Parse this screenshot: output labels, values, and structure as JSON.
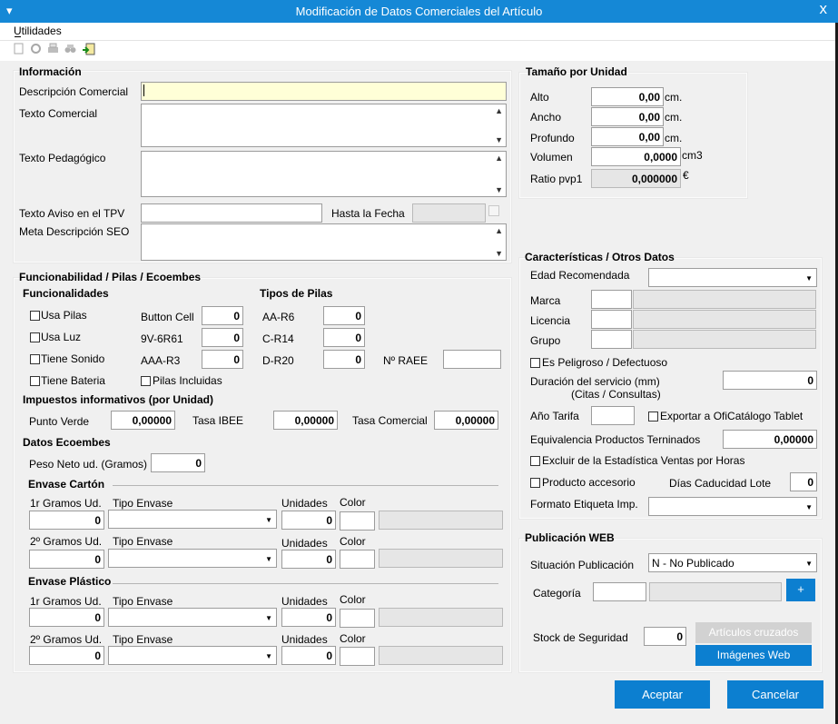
{
  "window": {
    "title": "Modificación de Datos Comerciales del Artículo",
    "close_glyph": "x",
    "sys_glyph": "▾"
  },
  "menu": {
    "utilidades": "Utilidades"
  },
  "toolbar": {
    "icons": [
      "new-doc-icon",
      "refresh-icon",
      "print-icon",
      "binoculars-icon",
      "exit-icon"
    ]
  },
  "info": {
    "heading": "Información",
    "descripcion_label": "Descripción Comercial",
    "descripcion_value": "",
    "texto_comercial_label": "Texto Comercial",
    "texto_pedagogico_label": "Texto Pedagógico",
    "aviso_label": "Texto Aviso en el TPV",
    "hasta_fecha_label": "Hasta la Fecha",
    "meta_label": "Meta Descripción SEO"
  },
  "funcionalidad": {
    "heading": "Funcionabilidad / Pilas / Ecoembes",
    "funcionalidades_heading": "Funcionalidades",
    "tipos_pilas_heading": "Tipos de Pilas",
    "checks": [
      "Usa Pilas",
      "Usa Luz",
      "Tiene Sonido",
      "Tiene Bateria"
    ],
    "pilas_incluidas": "Pilas Incluidas",
    "col1": [
      {
        "label": "Button Cell",
        "value": "0"
      },
      {
        "label": "9V-6R61",
        "value": "0"
      },
      {
        "label": "AAA-R3",
        "value": "0"
      }
    ],
    "col2": [
      {
        "label": "AA-R6",
        "value": "0"
      },
      {
        "label": "C-R14",
        "value": "0"
      },
      {
        "label": "D-R20",
        "value": "0"
      }
    ],
    "raee_label": "Nº RAEE",
    "impuestos_heading": "Impuestos informativos (por Unidad)",
    "punto_verde_label": "Punto Verde",
    "punto_verde_value": "0,00000",
    "tasa_ibee_label": "Tasa IBEE",
    "tasa_ibee_value": "0,00000",
    "tasa_comercial_label": "Tasa Comercial",
    "tasa_comercial_value": "0,00000",
    "ecoembes_heading": "Datos Ecoembes",
    "peso_label": "Peso Neto ud. (Gramos)",
    "peso_value": "0",
    "carton_heading": "Envase Cartón",
    "plastico_heading": "Envase Plástico",
    "row1_label": "1r Gramos Ud.",
    "row2_label": "2º Gramos Ud.",
    "tipo_envase_label": "Tipo Envase",
    "unidades_label": "Unidades",
    "color_label": "Color",
    "zero": "0"
  },
  "tamano": {
    "heading": "Tamaño por Unidad",
    "alto_label": "Alto",
    "alto_value": "0,00",
    "alto_unit": "cm.",
    "ancho_label": "Ancho",
    "ancho_value": "0,00",
    "ancho_unit": "cm.",
    "profundo_label": "Profundo",
    "profundo_value": "0,00",
    "profundo_unit": "cm.",
    "volumen_label": "Volumen",
    "volumen_value": "0,0000",
    "volumen_unit": "cm3",
    "ratio_label": "Ratio pvp1",
    "ratio_value": "0,000000",
    "ratio_unit": "€"
  },
  "caracteristicas": {
    "heading": "Características / Otros Datos",
    "edad_label": "Edad Recomendada",
    "marca_label": "Marca",
    "licencia_label": "Licencia",
    "grupo_label": "Grupo",
    "peligroso_label": "Es Peligroso / Defectuoso",
    "duracion_label": "Duración del servicio (mm)",
    "duracion_sub": "(Citas / Consultas)",
    "duracion_value": "0",
    "ano_tarifa_label": "Año Tarifa",
    "exportar_label": "Exportar a OfiCatálogo Tablet",
    "equivalencia_label": "Equivalencia Productos Terninados",
    "equivalencia_value": "0,00000",
    "excluir_label": "Excluir de la Estadística Ventas por Horas",
    "accesorio_label": "Producto accesorio",
    "dias_caducidad_label": "Días Caducidad Lote",
    "dias_caducidad_value": "0",
    "formato_label": "Formato Etiqueta Imp."
  },
  "publicacion": {
    "heading": "Publicación WEB",
    "situacion_label": "Situación Publicación",
    "situacion_value": "N - No Publicado",
    "categoria_label": "Categoría",
    "plus_label": "+",
    "stock_label": "Stock de Seguridad",
    "stock_value": "0",
    "articulos_button": "Artículos cruzados",
    "imagenes_button": "Imágenes Web"
  },
  "footer": {
    "aceptar": "Aceptar",
    "cancelar": "Cancelar"
  },
  "colors": {
    "accent": "#0c7fd0",
    "titlebar": "#1588d6",
    "required": "#ffffd7"
  }
}
